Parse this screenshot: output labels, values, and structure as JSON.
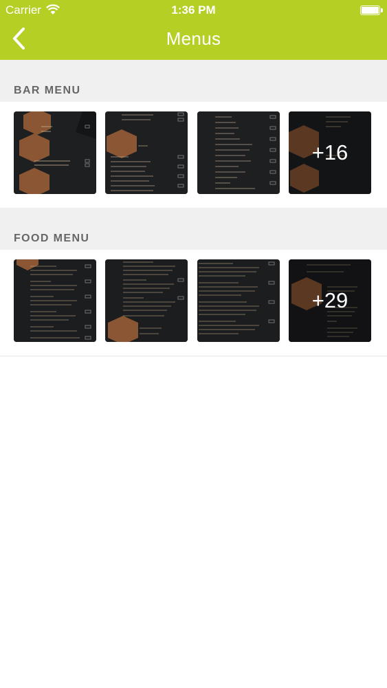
{
  "status_bar": {
    "carrier": "Carrier",
    "time": "1:36 PM"
  },
  "nav": {
    "title": "Menus",
    "back_icon": "chevron-left-icon"
  },
  "colors": {
    "nav_bar": "#b5cf24",
    "section_bg": "#f0f0f0",
    "section_text": "#666666",
    "thumb_bg": "#202122",
    "accent_copper": "#8a5633"
  },
  "sections": [
    {
      "title": "BAR MENU",
      "more_count": "+16"
    },
    {
      "title": "FOOD MENU",
      "more_count": "+29"
    }
  ]
}
